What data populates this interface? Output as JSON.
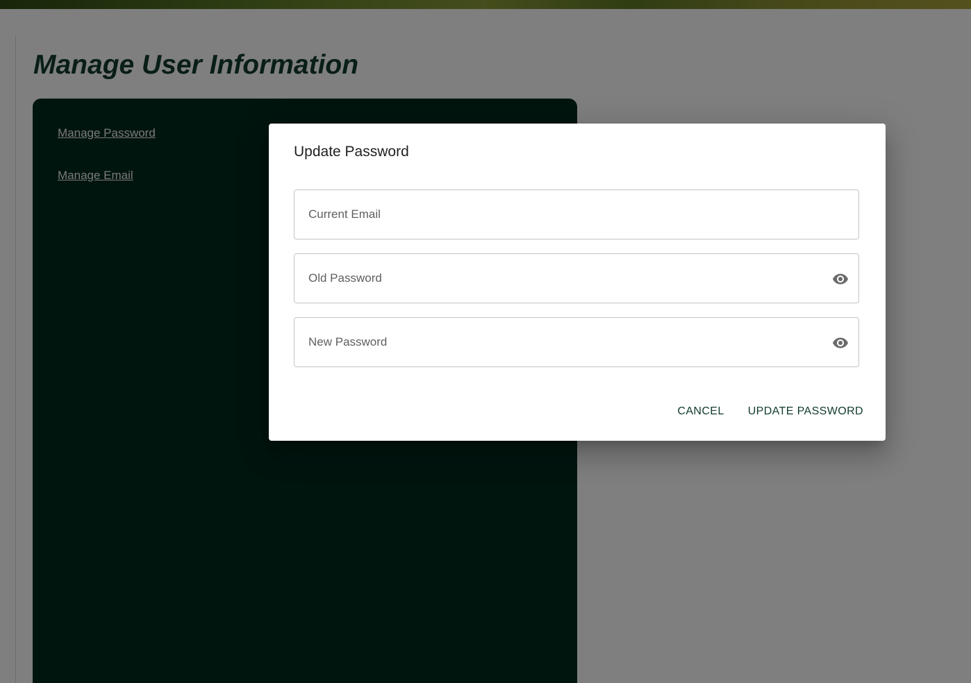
{
  "page": {
    "title": "Manage User Information"
  },
  "sidebar": {
    "links": [
      {
        "label": "Manage Password"
      },
      {
        "label": "Manage Email"
      }
    ]
  },
  "dialog": {
    "title": "Update Password",
    "fields": [
      {
        "placeholder": "Current Email",
        "value": "",
        "type": "email",
        "icon": null
      },
      {
        "placeholder": "Old Password",
        "value": "",
        "type": "password",
        "icon": "eye-icon"
      },
      {
        "placeholder": "New Password",
        "value": "",
        "type": "password",
        "icon": "eye-icon"
      }
    ],
    "cancel_label": "CANCEL",
    "submit_label": "UPDATE PASSWORD"
  },
  "colors": {
    "heading": "#123d2c",
    "panel": "#022a1e",
    "button_text": "#0f3b2a",
    "backdrop": "rgba(0,0,0,0.5)"
  }
}
